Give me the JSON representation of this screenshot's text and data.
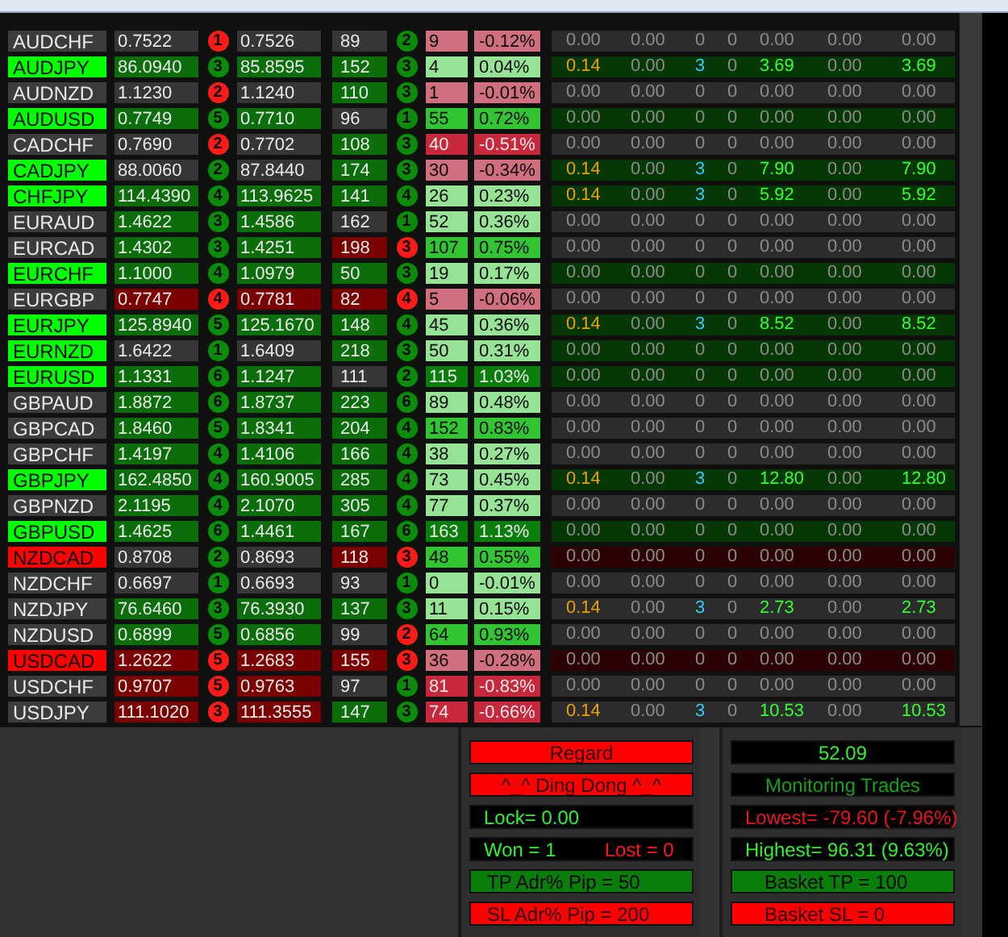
{
  "rows": [
    {
      "symbol": {
        "text": "AUDCHF",
        "color": "#3c3c3c"
      },
      "bid": {
        "text": "0.7522",
        "color": "#363636"
      },
      "signal": {
        "text": "1",
        "color": "#ff1a1a"
      },
      "ask": {
        "text": "0.7526",
        "color": "#363636"
      },
      "pips": {
        "text": "89",
        "color": "#363636"
      },
      "signal2": {
        "text": "2",
        "color": "#0b8a0b"
      },
      "count": {
        "text": "9",
        "color": "#d0707e"
      },
      "pct": {
        "text": "-0.12%",
        "color": "#d0707e"
      },
      "trades": {
        "color": "#2c2c2c",
        "active": false,
        "cells": [
          "0.00",
          "0.00",
          "0",
          "0",
          "0.00",
          "0.00",
          "0.00"
        ]
      }
    },
    {
      "symbol": {
        "text": "AUDJPY",
        "color": "#00ff00"
      },
      "bid": {
        "text": "86.0940",
        "color": "#0b6e0b"
      },
      "signal": {
        "text": "3",
        "color": "#0b8a0b"
      },
      "ask": {
        "text": "85.8595",
        "color": "#0b6e0b"
      },
      "pips": {
        "text": "152",
        "color": "#0b6e0b"
      },
      "signal2": {
        "text": "3",
        "color": "#0b8a0b"
      },
      "count": {
        "text": "4",
        "color": "#96e396"
      },
      "pct": {
        "text": "0.04%",
        "color": "#96e396"
      },
      "trades": {
        "color": "#063806",
        "active": true,
        "cells": [
          "0.14",
          "0.00",
          "3",
          "0",
          "3.69",
          "0.00",
          "3.69"
        ]
      }
    },
    {
      "symbol": {
        "text": "AUDNZD",
        "color": "#3c3c3c"
      },
      "bid": {
        "text": "1.1230",
        "color": "#363636"
      },
      "signal": {
        "text": "2",
        "color": "#ff1a1a"
      },
      "ask": {
        "text": "1.1240",
        "color": "#363636"
      },
      "pips": {
        "text": "110",
        "color": "#0b6e0b"
      },
      "signal2": {
        "text": "3",
        "color": "#0b8a0b"
      },
      "count": {
        "text": "1",
        "color": "#d0707e"
      },
      "pct": {
        "text": "-0.01%",
        "color": "#d0707e"
      },
      "trades": {
        "color": "#2c2c2c",
        "active": false,
        "cells": [
          "0.00",
          "0.00",
          "0",
          "0",
          "0.00",
          "0.00",
          "0.00"
        ]
      }
    },
    {
      "symbol": {
        "text": "AUDUSD",
        "color": "#00ff00"
      },
      "bid": {
        "text": "0.7749",
        "color": "#0b6e0b"
      },
      "signal": {
        "text": "5",
        "color": "#0b8a0b"
      },
      "ask": {
        "text": "0.7710",
        "color": "#0b6e0b"
      },
      "pips": {
        "text": "96",
        "color": "#363636"
      },
      "signal2": {
        "text": "1",
        "color": "#0b8a0b"
      },
      "count": {
        "text": "55",
        "color": "#33c433"
      },
      "pct": {
        "text": "0.72%",
        "color": "#33c433"
      },
      "trades": {
        "color": "#063806",
        "active": false,
        "cells": [
          "0.00",
          "0.00",
          "0",
          "0",
          "0.00",
          "0.00",
          "0.00"
        ]
      }
    },
    {
      "symbol": {
        "text": "CADCHF",
        "color": "#3c3c3c"
      },
      "bid": {
        "text": "0.7690",
        "color": "#363636"
      },
      "signal": {
        "text": "2",
        "color": "#ff1a1a"
      },
      "ask": {
        "text": "0.7702",
        "color": "#363636"
      },
      "pips": {
        "text": "108",
        "color": "#0b6e0b"
      },
      "signal2": {
        "text": "3",
        "color": "#0b8a0b"
      },
      "count": {
        "text": "40",
        "color": "#c8283c"
      },
      "pct": {
        "text": "-0.51%",
        "color": "#c8283c"
      },
      "trades": {
        "color": "#2c2c2c",
        "active": false,
        "cells": [
          "0.00",
          "0.00",
          "0",
          "0",
          "0.00",
          "0.00",
          "0.00"
        ]
      }
    },
    {
      "symbol": {
        "text": "CADJPY",
        "color": "#00ff00"
      },
      "bid": {
        "text": "88.0060",
        "color": "#363636"
      },
      "signal": {
        "text": "2",
        "color": "#0b8a0b"
      },
      "ask": {
        "text": "87.8440",
        "color": "#363636"
      },
      "pips": {
        "text": "174",
        "color": "#0b6e0b"
      },
      "signal2": {
        "text": "3",
        "color": "#0b8a0b"
      },
      "count": {
        "text": "30",
        "color": "#d0707e"
      },
      "pct": {
        "text": "-0.34%",
        "color": "#d0707e"
      },
      "trades": {
        "color": "#063806",
        "active": true,
        "cells": [
          "0.14",
          "0.00",
          "3",
          "0",
          "7.90",
          "0.00",
          "7.90"
        ]
      }
    },
    {
      "symbol": {
        "text": "CHFJPY",
        "color": "#00ff00"
      },
      "bid": {
        "text": "114.4390",
        "color": "#0b6e0b"
      },
      "signal": {
        "text": "4",
        "color": "#0b8a0b"
      },
      "ask": {
        "text": "113.9625",
        "color": "#0b6e0b"
      },
      "pips": {
        "text": "141",
        "color": "#0b6e0b"
      },
      "signal2": {
        "text": "4",
        "color": "#0b8a0b"
      },
      "count": {
        "text": "26",
        "color": "#96e396"
      },
      "pct": {
        "text": "0.23%",
        "color": "#96e396"
      },
      "trades": {
        "color": "#063806",
        "active": true,
        "cells": [
          "0.14",
          "0.00",
          "3",
          "0",
          "5.92",
          "0.00",
          "5.92"
        ]
      }
    },
    {
      "symbol": {
        "text": "EURAUD",
        "color": "#3c3c3c"
      },
      "bid": {
        "text": "1.4622",
        "color": "#0b6e0b"
      },
      "signal": {
        "text": "3",
        "color": "#0b8a0b"
      },
      "ask": {
        "text": "1.4586",
        "color": "#0b6e0b"
      },
      "pips": {
        "text": "162",
        "color": "#363636"
      },
      "signal2": {
        "text": "1",
        "color": "#0b8a0b"
      },
      "count": {
        "text": "52",
        "color": "#96e396"
      },
      "pct": {
        "text": "0.36%",
        "color": "#96e396"
      },
      "trades": {
        "color": "#2c2c2c",
        "active": false,
        "cells": [
          "0.00",
          "0.00",
          "0",
          "0",
          "0.00",
          "0.00",
          "0.00"
        ]
      }
    },
    {
      "symbol": {
        "text": "EURCAD",
        "color": "#3c3c3c"
      },
      "bid": {
        "text": "1.4302",
        "color": "#0b6e0b"
      },
      "signal": {
        "text": "3",
        "color": "#0b8a0b"
      },
      "ask": {
        "text": "1.4251",
        "color": "#0b6e0b"
      },
      "pips": {
        "text": "198",
        "color": "#7a0000"
      },
      "signal2": {
        "text": "3",
        "color": "#ff1a1a"
      },
      "count": {
        "text": "107",
        "color": "#33c433"
      },
      "pct": {
        "text": "0.75%",
        "color": "#33c433"
      },
      "trades": {
        "color": "#2c2c2c",
        "active": false,
        "cells": [
          "0.00",
          "0.00",
          "0",
          "0",
          "0.00",
          "0.00",
          "0.00"
        ]
      }
    },
    {
      "symbol": {
        "text": "EURCHF",
        "color": "#00ff00"
      },
      "bid": {
        "text": "1.1000",
        "color": "#0b6e0b"
      },
      "signal": {
        "text": "4",
        "color": "#0b8a0b"
      },
      "ask": {
        "text": "1.0979",
        "color": "#0b6e0b"
      },
      "pips": {
        "text": "50",
        "color": "#0b6e0b"
      },
      "signal2": {
        "text": "3",
        "color": "#0b8a0b"
      },
      "count": {
        "text": "19",
        "color": "#96e396"
      },
      "pct": {
        "text": "0.17%",
        "color": "#96e396"
      },
      "trades": {
        "color": "#063806",
        "active": false,
        "cells": [
          "0.00",
          "0.00",
          "0",
          "0",
          "0.00",
          "0.00",
          "0.00"
        ]
      }
    },
    {
      "symbol": {
        "text": "EURGBP",
        "color": "#3c3c3c"
      },
      "bid": {
        "text": "0.7747",
        "color": "#7a0000"
      },
      "signal": {
        "text": "4",
        "color": "#ff1a1a"
      },
      "ask": {
        "text": "0.7781",
        "color": "#7a0000"
      },
      "pips": {
        "text": "82",
        "color": "#7a0000"
      },
      "signal2": {
        "text": "4",
        "color": "#ff1a1a"
      },
      "count": {
        "text": "5",
        "color": "#d0707e"
      },
      "pct": {
        "text": "-0.06%",
        "color": "#d0707e"
      },
      "trades": {
        "color": "#2c2c2c",
        "active": false,
        "cells": [
          "0.00",
          "0.00",
          "0",
          "0",
          "0.00",
          "0.00",
          "0.00"
        ]
      }
    },
    {
      "symbol": {
        "text": "EURJPY",
        "color": "#00ff00"
      },
      "bid": {
        "text": "125.8940",
        "color": "#0b6e0b"
      },
      "signal": {
        "text": "5",
        "color": "#0b8a0b"
      },
      "ask": {
        "text": "125.1670",
        "color": "#0b6e0b"
      },
      "pips": {
        "text": "148",
        "color": "#0b6e0b"
      },
      "signal2": {
        "text": "4",
        "color": "#0b8a0b"
      },
      "count": {
        "text": "45",
        "color": "#96e396"
      },
      "pct": {
        "text": "0.36%",
        "color": "#96e396"
      },
      "trades": {
        "color": "#063806",
        "active": true,
        "cells": [
          "0.14",
          "0.00",
          "3",
          "0",
          "8.52",
          "0.00",
          "8.52"
        ]
      }
    },
    {
      "symbol": {
        "text": "EURNZD",
        "color": "#00ff00"
      },
      "bid": {
        "text": "1.6422",
        "color": "#363636"
      },
      "signal": {
        "text": "1",
        "color": "#0b8a0b"
      },
      "ask": {
        "text": "1.6409",
        "color": "#363636"
      },
      "pips": {
        "text": "218",
        "color": "#0b6e0b"
      },
      "signal2": {
        "text": "3",
        "color": "#0b8a0b"
      },
      "count": {
        "text": "50",
        "color": "#96e396"
      },
      "pct": {
        "text": "0.31%",
        "color": "#96e396"
      },
      "trades": {
        "color": "#063806",
        "active": false,
        "cells": [
          "0.00",
          "0.00",
          "0",
          "0",
          "0.00",
          "0.00",
          "0.00"
        ]
      }
    },
    {
      "symbol": {
        "text": "EURUSD",
        "color": "#00ff00"
      },
      "bid": {
        "text": "1.1331",
        "color": "#0b6e0b"
      },
      "signal": {
        "text": "6",
        "color": "#0b8a0b"
      },
      "ask": {
        "text": "1.1247",
        "color": "#0b6e0b"
      },
      "pips": {
        "text": "111",
        "color": "#363636"
      },
      "signal2": {
        "text": "2",
        "color": "#0b8a0b"
      },
      "count": {
        "text": "115",
        "color": "#0a7e0a"
      },
      "pct": {
        "text": "1.03%",
        "color": "#0a7e0a"
      },
      "trades": {
        "color": "#063806",
        "active": false,
        "cells": [
          "0.00",
          "0.00",
          "0",
          "0",
          "0.00",
          "0.00",
          "0.00"
        ]
      }
    },
    {
      "symbol": {
        "text": "GBPAUD",
        "color": "#3c3c3c"
      },
      "bid": {
        "text": "1.8872",
        "color": "#0b6e0b"
      },
      "signal": {
        "text": "6",
        "color": "#0b8a0b"
      },
      "ask": {
        "text": "1.8737",
        "color": "#0b6e0b"
      },
      "pips": {
        "text": "223",
        "color": "#0b6e0b"
      },
      "signal2": {
        "text": "6",
        "color": "#0b8a0b"
      },
      "count": {
        "text": "89",
        "color": "#96e396"
      },
      "pct": {
        "text": "0.48%",
        "color": "#96e396"
      },
      "trades": {
        "color": "#2c2c2c",
        "active": false,
        "cells": [
          "0.00",
          "0.00",
          "0",
          "0",
          "0.00",
          "0.00",
          "0.00"
        ]
      }
    },
    {
      "symbol": {
        "text": "GBPCAD",
        "color": "#3c3c3c"
      },
      "bid": {
        "text": "1.8460",
        "color": "#0b6e0b"
      },
      "signal": {
        "text": "5",
        "color": "#0b8a0b"
      },
      "ask": {
        "text": "1.8341",
        "color": "#0b6e0b"
      },
      "pips": {
        "text": "204",
        "color": "#0b6e0b"
      },
      "signal2": {
        "text": "4",
        "color": "#0b8a0b"
      },
      "count": {
        "text": "152",
        "color": "#33c433"
      },
      "pct": {
        "text": "0.83%",
        "color": "#33c433"
      },
      "trades": {
        "color": "#2c2c2c",
        "active": false,
        "cells": [
          "0.00",
          "0.00",
          "0",
          "0",
          "0.00",
          "0.00",
          "0.00"
        ]
      }
    },
    {
      "symbol": {
        "text": "GBPCHF",
        "color": "#3c3c3c"
      },
      "bid": {
        "text": "1.4197",
        "color": "#0b6e0b"
      },
      "signal": {
        "text": "4",
        "color": "#0b8a0b"
      },
      "ask": {
        "text": "1.4106",
        "color": "#0b6e0b"
      },
      "pips": {
        "text": "166",
        "color": "#0b6e0b"
      },
      "signal2": {
        "text": "4",
        "color": "#0b8a0b"
      },
      "count": {
        "text": "38",
        "color": "#96e396"
      },
      "pct": {
        "text": "0.27%",
        "color": "#96e396"
      },
      "trades": {
        "color": "#2c2c2c",
        "active": false,
        "cells": [
          "0.00",
          "0.00",
          "0",
          "0",
          "0.00",
          "0.00",
          "0.00"
        ]
      }
    },
    {
      "symbol": {
        "text": "GBPJPY",
        "color": "#00ff00"
      },
      "bid": {
        "text": "162.4850",
        "color": "#0b6e0b"
      },
      "signal": {
        "text": "4",
        "color": "#0b8a0b"
      },
      "ask": {
        "text": "160.9005",
        "color": "#0b6e0b"
      },
      "pips": {
        "text": "285",
        "color": "#0b6e0b"
      },
      "signal2": {
        "text": "4",
        "color": "#0b8a0b"
      },
      "count": {
        "text": "73",
        "color": "#96e396"
      },
      "pct": {
        "text": "0.45%",
        "color": "#96e396"
      },
      "trades": {
        "color": "#063806",
        "active": true,
        "cells": [
          "0.14",
          "0.00",
          "3",
          "0",
          "12.80",
          "0.00",
          "12.80"
        ]
      }
    },
    {
      "symbol": {
        "text": "GBPNZD",
        "color": "#3c3c3c"
      },
      "bid": {
        "text": "2.1195",
        "color": "#0b6e0b"
      },
      "signal": {
        "text": "4",
        "color": "#0b8a0b"
      },
      "ask": {
        "text": "2.1070",
        "color": "#0b6e0b"
      },
      "pips": {
        "text": "305",
        "color": "#0b6e0b"
      },
      "signal2": {
        "text": "4",
        "color": "#0b8a0b"
      },
      "count": {
        "text": "77",
        "color": "#96e396"
      },
      "pct": {
        "text": "0.37%",
        "color": "#96e396"
      },
      "trades": {
        "color": "#2c2c2c",
        "active": false,
        "cells": [
          "0.00",
          "0.00",
          "0",
          "0",
          "0.00",
          "0.00",
          "0.00"
        ]
      }
    },
    {
      "symbol": {
        "text": "GBPUSD",
        "color": "#00ff00"
      },
      "bid": {
        "text": "1.4625",
        "color": "#0b6e0b"
      },
      "signal": {
        "text": "6",
        "color": "#0b8a0b"
      },
      "ask": {
        "text": "1.4461",
        "color": "#0b6e0b"
      },
      "pips": {
        "text": "167",
        "color": "#0b6e0b"
      },
      "signal2": {
        "text": "6",
        "color": "#0b8a0b"
      },
      "count": {
        "text": "163",
        "color": "#0a7e0a"
      },
      "pct": {
        "text": "1.13%",
        "color": "#0a7e0a"
      },
      "trades": {
        "color": "#063806",
        "active": false,
        "cells": [
          "0.00",
          "0.00",
          "0",
          "0",
          "0.00",
          "0.00",
          "0.00"
        ]
      }
    },
    {
      "symbol": {
        "text": "NZDCAD",
        "color": "#ff0000"
      },
      "bid": {
        "text": "0.8708",
        "color": "#363636"
      },
      "signal": {
        "text": "2",
        "color": "#0b8a0b"
      },
      "ask": {
        "text": "0.8693",
        "color": "#363636"
      },
      "pips": {
        "text": "118",
        "color": "#7a0000"
      },
      "signal2": {
        "text": "3",
        "color": "#ff1a1a"
      },
      "count": {
        "text": "48",
        "color": "#33c433"
      },
      "pct": {
        "text": "0.55%",
        "color": "#33c433"
      },
      "trades": {
        "color": "#2c0202",
        "active": false,
        "cells": [
          "0.00",
          "0.00",
          "0",
          "0",
          "0.00",
          "0.00",
          "0.00"
        ]
      }
    },
    {
      "symbol": {
        "text": "NZDCHF",
        "color": "#3c3c3c"
      },
      "bid": {
        "text": "0.6697",
        "color": "#363636"
      },
      "signal": {
        "text": "1",
        "color": "#0b8a0b"
      },
      "ask": {
        "text": "0.6693",
        "color": "#363636"
      },
      "pips": {
        "text": "93",
        "color": "#363636"
      },
      "signal2": {
        "text": "1",
        "color": "#0b8a0b"
      },
      "count": {
        "text": "0",
        "color": "#96e396"
      },
      "pct": {
        "text": "-0.01%",
        "color": "#96e396"
      },
      "trades": {
        "color": "#2c2c2c",
        "active": false,
        "cells": [
          "0.00",
          "0.00",
          "0",
          "0",
          "0.00",
          "0.00",
          "0.00"
        ]
      }
    },
    {
      "symbol": {
        "text": "NZDJPY",
        "color": "#3c3c3c"
      },
      "bid": {
        "text": "76.6460",
        "color": "#0b6e0b"
      },
      "signal": {
        "text": "3",
        "color": "#0b8a0b"
      },
      "ask": {
        "text": "76.3930",
        "color": "#0b6e0b"
      },
      "pips": {
        "text": "137",
        "color": "#0b6e0b"
      },
      "signal2": {
        "text": "3",
        "color": "#0b8a0b"
      },
      "count": {
        "text": "11",
        "color": "#96e396"
      },
      "pct": {
        "text": "0.15%",
        "color": "#96e396"
      },
      "trades": {
        "color": "#2c2c2c",
        "active": true,
        "cells": [
          "0.14",
          "0.00",
          "3",
          "0",
          "2.73",
          "0.00",
          "2.73"
        ]
      }
    },
    {
      "symbol": {
        "text": "NZDUSD",
        "color": "#3c3c3c"
      },
      "bid": {
        "text": "0.6899",
        "color": "#0b6e0b"
      },
      "signal": {
        "text": "5",
        "color": "#0b8a0b"
      },
      "ask": {
        "text": "0.6856",
        "color": "#0b6e0b"
      },
      "pips": {
        "text": "99",
        "color": "#363636"
      },
      "signal2": {
        "text": "2",
        "color": "#ff1a1a"
      },
      "count": {
        "text": "64",
        "color": "#33c433"
      },
      "pct": {
        "text": "0.93%",
        "color": "#33c433"
      },
      "trades": {
        "color": "#2c2c2c",
        "active": false,
        "cells": [
          "0.00",
          "0.00",
          "0",
          "0",
          "0.00",
          "0.00",
          "0.00"
        ]
      }
    },
    {
      "symbol": {
        "text": "USDCAD",
        "color": "#ff0000"
      },
      "bid": {
        "text": "1.2622",
        "color": "#7a0000"
      },
      "signal": {
        "text": "5",
        "color": "#ff1a1a"
      },
      "ask": {
        "text": "1.2683",
        "color": "#7a0000"
      },
      "pips": {
        "text": "155",
        "color": "#7a0000"
      },
      "signal2": {
        "text": "3",
        "color": "#ff1a1a"
      },
      "count": {
        "text": "36",
        "color": "#d0707e"
      },
      "pct": {
        "text": "-0.28%",
        "color": "#d0707e"
      },
      "trades": {
        "color": "#2c0202",
        "active": false,
        "cells": [
          "0.00",
          "0.00",
          "0",
          "0",
          "0.00",
          "0.00",
          "0.00"
        ]
      }
    },
    {
      "symbol": {
        "text": "USDCHF",
        "color": "#3c3c3c"
      },
      "bid": {
        "text": "0.9707",
        "color": "#7a0000"
      },
      "signal": {
        "text": "5",
        "color": "#ff1a1a"
      },
      "ask": {
        "text": "0.9763",
        "color": "#7a0000"
      },
      "pips": {
        "text": "97",
        "color": "#363636"
      },
      "signal2": {
        "text": "1",
        "color": "#0b8a0b"
      },
      "count": {
        "text": "81",
        "color": "#c8283c"
      },
      "pct": {
        "text": "-0.83%",
        "color": "#c8283c"
      },
      "trades": {
        "color": "#2c2c2c",
        "active": false,
        "cells": [
          "0.00",
          "0.00",
          "0",
          "0",
          "0.00",
          "0.00",
          "0.00"
        ]
      }
    },
    {
      "symbol": {
        "text": "USDJPY",
        "color": "#3c3c3c"
      },
      "bid": {
        "text": "111.1020",
        "color": "#7a0000"
      },
      "signal": {
        "text": "3",
        "color": "#ff1a1a"
      },
      "ask": {
        "text": "111.3555",
        "color": "#7a0000"
      },
      "pips": {
        "text": "147",
        "color": "#0b6e0b"
      },
      "signal2": {
        "text": "3",
        "color": "#0b8a0b"
      },
      "count": {
        "text": "74",
        "color": "#c8283c"
      },
      "pct": {
        "text": "-0.66%",
        "color": "#c8283c"
      },
      "trades": {
        "color": "#2c2c2c",
        "active": true,
        "cells": [
          "0.14",
          "0.00",
          "3",
          "0",
          "10.53",
          "0.00",
          "10.53"
        ]
      }
    }
  ],
  "left_panel": [
    {
      "kind": "button",
      "text": "Regard"
    },
    {
      "kind": "button",
      "text": "^_^ Ding Dong ^_^"
    },
    {
      "kind": "gain",
      "text": "Lock= 0.00"
    },
    {
      "kind": "score",
      "won": "Won =  1",
      "lost": "Lost =  0"
    },
    {
      "kind": "positive",
      "text": "TP Adr% Pip = 50"
    },
    {
      "kind": "alarm",
      "text": "SL Adr% Pip = 200"
    }
  ],
  "right_panel": [
    {
      "kind": "total",
      "text": "52.09"
    },
    {
      "kind": "note",
      "text": "Monitoring Trades"
    },
    {
      "kind": "loss",
      "text": "Lowest= -79.60 (-7.96%)"
    },
    {
      "kind": "gain",
      "text": "Highest= 96.31 (9.63%)"
    },
    {
      "kind": "positive",
      "text": "Basket TP = 100"
    },
    {
      "kind": "alarm",
      "text": "Basket SL = 0"
    }
  ]
}
